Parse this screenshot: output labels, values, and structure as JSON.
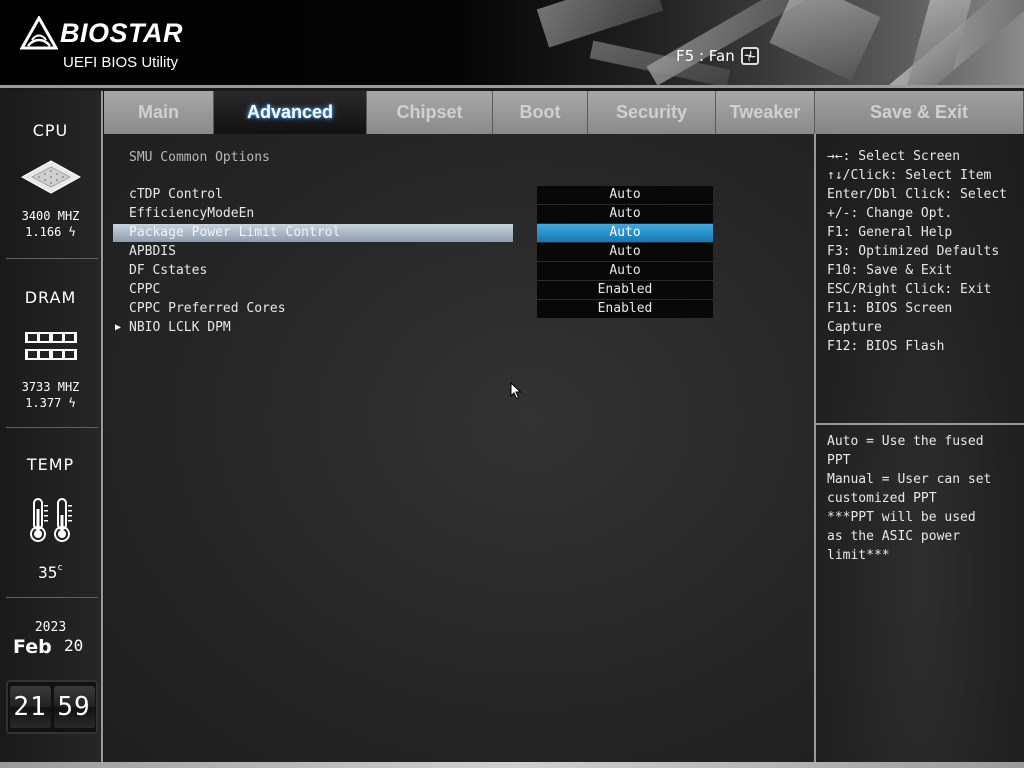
{
  "header": {
    "brand": "BIOSTAR",
    "subtitle": "UEFI BIOS Utility",
    "fan_hint": "F5 : Fan"
  },
  "sidebar": {
    "cpu": {
      "title": "CPU",
      "freq": "3400 MHZ",
      "volt": "1.166"
    },
    "dram": {
      "title": "DRAM",
      "freq": "3733 MHZ",
      "volt": "1.377"
    },
    "temp": {
      "title": "TEMP",
      "value": "35",
      "unit": "c"
    },
    "date": {
      "year": "2023",
      "month": "Feb",
      "day": "20"
    },
    "clock": {
      "hours": "21",
      "minutes": "59"
    }
  },
  "tabs": [
    {
      "label": "Main",
      "active": false
    },
    {
      "label": "Advanced",
      "active": true
    },
    {
      "label": "Chipset",
      "active": false
    },
    {
      "label": "Boot",
      "active": false
    },
    {
      "label": "Security",
      "active": false
    },
    {
      "label": "Tweaker",
      "active": false
    },
    {
      "label": "Save & Exit",
      "active": false
    }
  ],
  "main": {
    "section_title": "SMU Common Options",
    "options": [
      {
        "label": "cTDP Control",
        "value": "Auto"
      },
      {
        "label": "EfficiencyModeEn",
        "value": "Auto"
      },
      {
        "label": "Package Power Limit Control",
        "value": "Auto",
        "selected": true
      },
      {
        "label": "APBDIS",
        "value": "Auto"
      },
      {
        "label": "DF Cstates",
        "value": "Auto"
      },
      {
        "label": "CPPC",
        "value": "Enabled"
      },
      {
        "label": "CPPC Preferred Cores",
        "value": "Enabled"
      },
      {
        "label": "NBIO LCLK DPM",
        "submenu": true
      }
    ]
  },
  "help": {
    "keys": [
      "→←: Select Screen",
      "↑↓/Click: Select Item",
      "Enter/Dbl Click: Select",
      "+/-: Change Opt.",
      "F1: General Help",
      "F3: Optimized Defaults",
      "F10: Save & Exit",
      "ESC/Right Click: Exit",
      "F11: BIOS Screen",
      "Capture",
      "F12: BIOS Flash"
    ],
    "description": [
      "Auto = Use the fused",
      "PPT",
      "Manual = User can set",
      "customized PPT",
      "***PPT will be used",
      "as the ASIC power",
      "limit***"
    ]
  },
  "colors": {
    "selected_value_bg": "#1f8fcf",
    "selected_row_bg": "#aab7c4",
    "active_tab_glow": "#4aa8ff"
  }
}
